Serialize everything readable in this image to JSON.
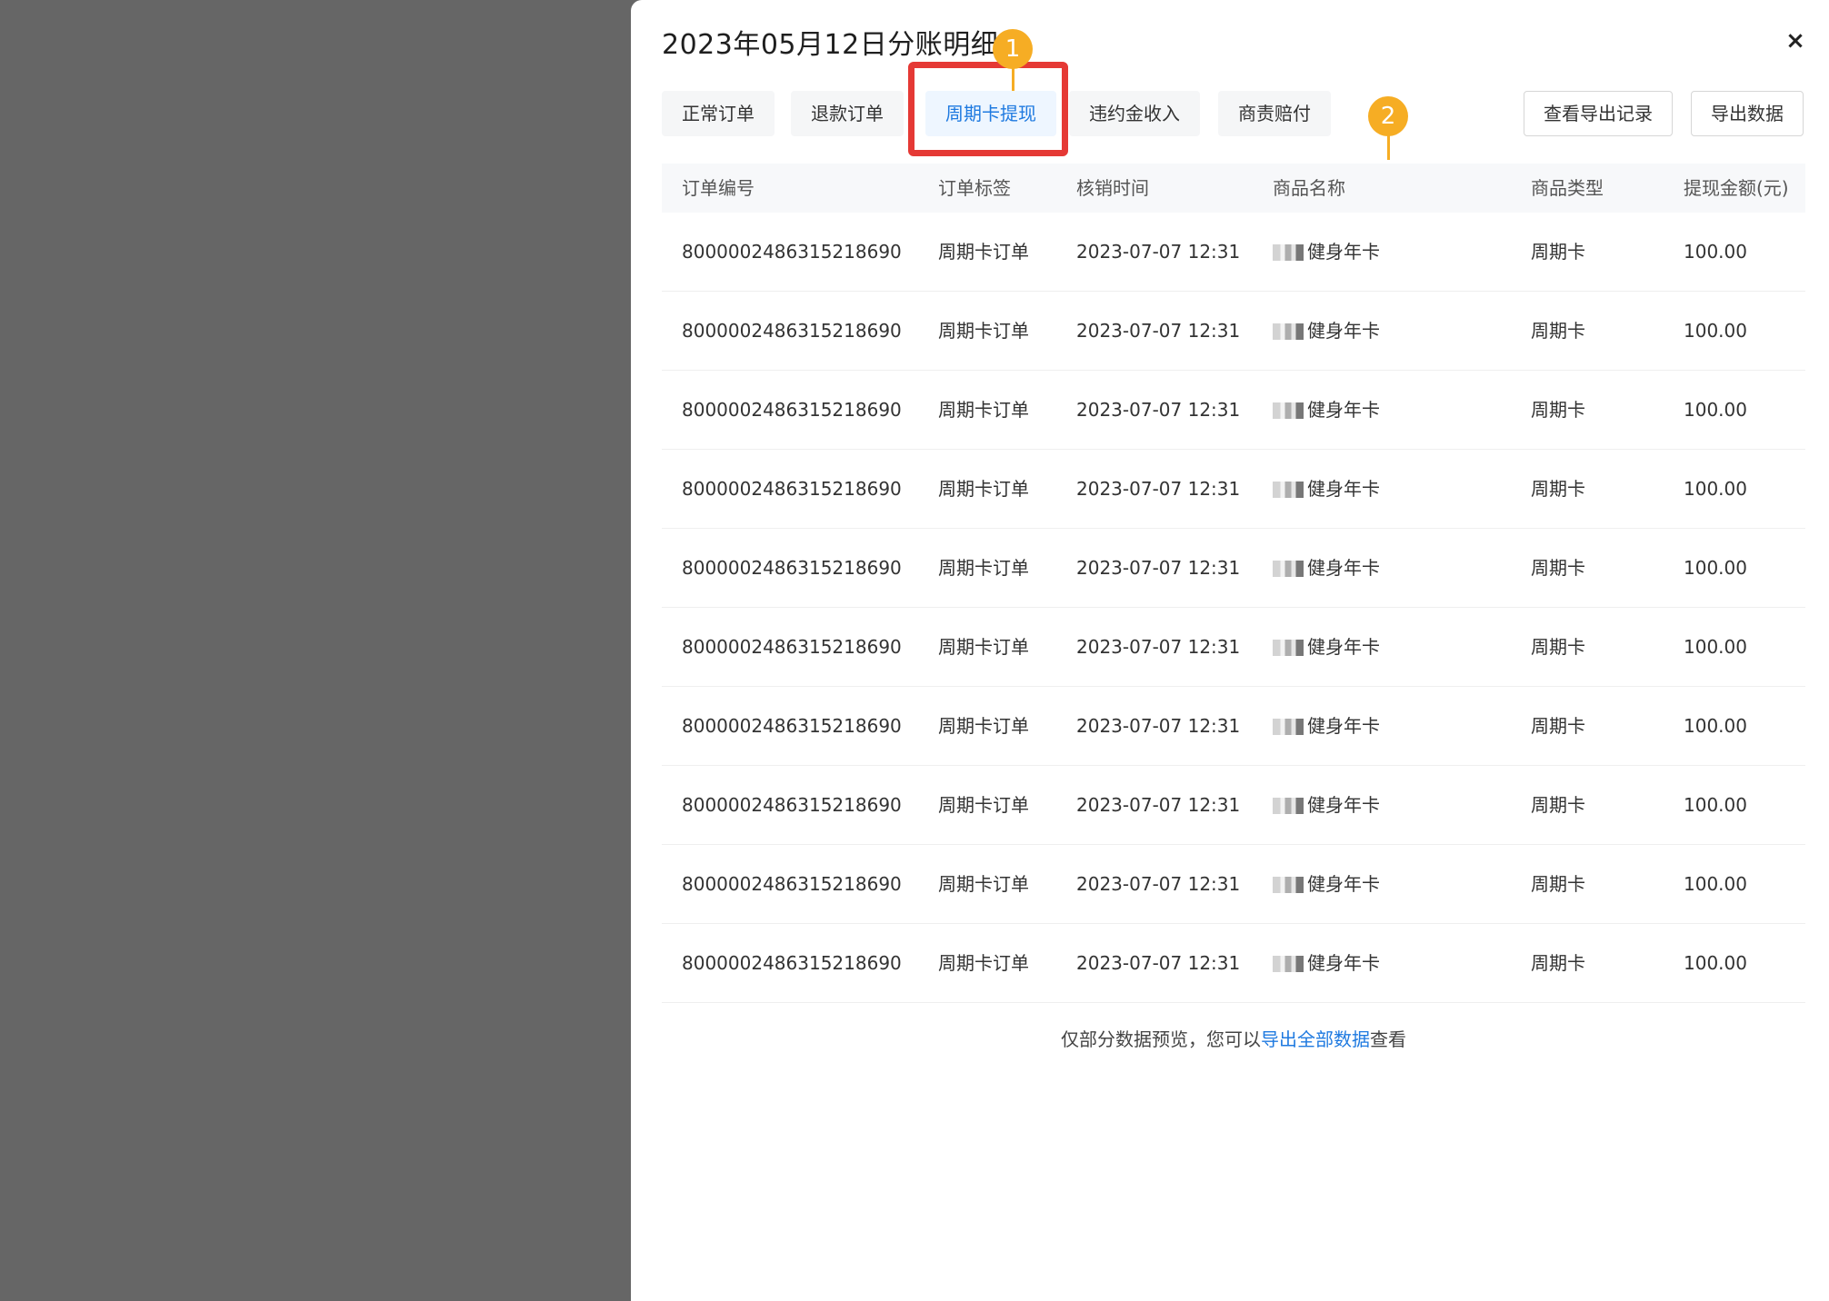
{
  "title": "2023年05月12日分账明细",
  "close_symbol": "×",
  "tabs": [
    {
      "label": "正常订单",
      "active": false
    },
    {
      "label": "退款订单",
      "active": false
    },
    {
      "label": "周期卡提现",
      "active": true
    },
    {
      "label": "违约金收入",
      "active": false
    },
    {
      "label": "商责赔付",
      "active": false
    }
  ],
  "buttons": {
    "view_export_records": "查看导出记录",
    "export_data": "导出数据"
  },
  "annotations": {
    "marker_1": "1",
    "marker_2": "2",
    "accent_color": "#f6ad24",
    "highlight_color": "#e53935"
  },
  "table": {
    "columns": [
      "订单编号",
      "订单标签",
      "核销时间",
      "商品名称",
      "商品类型",
      "提现金额(元)"
    ],
    "rows": [
      [
        "8000002486315218690",
        "周期卡订单",
        "2023-07-07 12:31",
        "健身年卡",
        "周期卡",
        "100.00"
      ],
      [
        "8000002486315218690",
        "周期卡订单",
        "2023-07-07 12:31",
        "健身年卡",
        "周期卡",
        "100.00"
      ],
      [
        "8000002486315218690",
        "周期卡订单",
        "2023-07-07 12:31",
        "健身年卡",
        "周期卡",
        "100.00"
      ],
      [
        "8000002486315218690",
        "周期卡订单",
        "2023-07-07 12:31",
        "健身年卡",
        "周期卡",
        "100.00"
      ],
      [
        "8000002486315218690",
        "周期卡订单",
        "2023-07-07 12:31",
        "健身年卡",
        "周期卡",
        "100.00"
      ],
      [
        "8000002486315218690",
        "周期卡订单",
        "2023-07-07 12:31",
        "健身年卡",
        "周期卡",
        "100.00"
      ],
      [
        "8000002486315218690",
        "周期卡订单",
        "2023-07-07 12:31",
        "健身年卡",
        "周期卡",
        "100.00"
      ],
      [
        "8000002486315218690",
        "周期卡订单",
        "2023-07-07 12:31",
        "健身年卡",
        "周期卡",
        "100.00"
      ],
      [
        "8000002486315218690",
        "周期卡订单",
        "2023-07-07 12:31",
        "健身年卡",
        "周期卡",
        "100.00"
      ],
      [
        "8000002486315218690",
        "周期卡订单",
        "2023-07-07 12:31",
        "健身年卡",
        "周期卡",
        "100.00"
      ]
    ]
  },
  "footer": {
    "prefix": "仅部分数据预览，您可以",
    "link": "导出全部数据",
    "suffix": "查看"
  },
  "colors": {
    "link_blue": "#1f7ae0",
    "overlay_gray": "#666666"
  }
}
